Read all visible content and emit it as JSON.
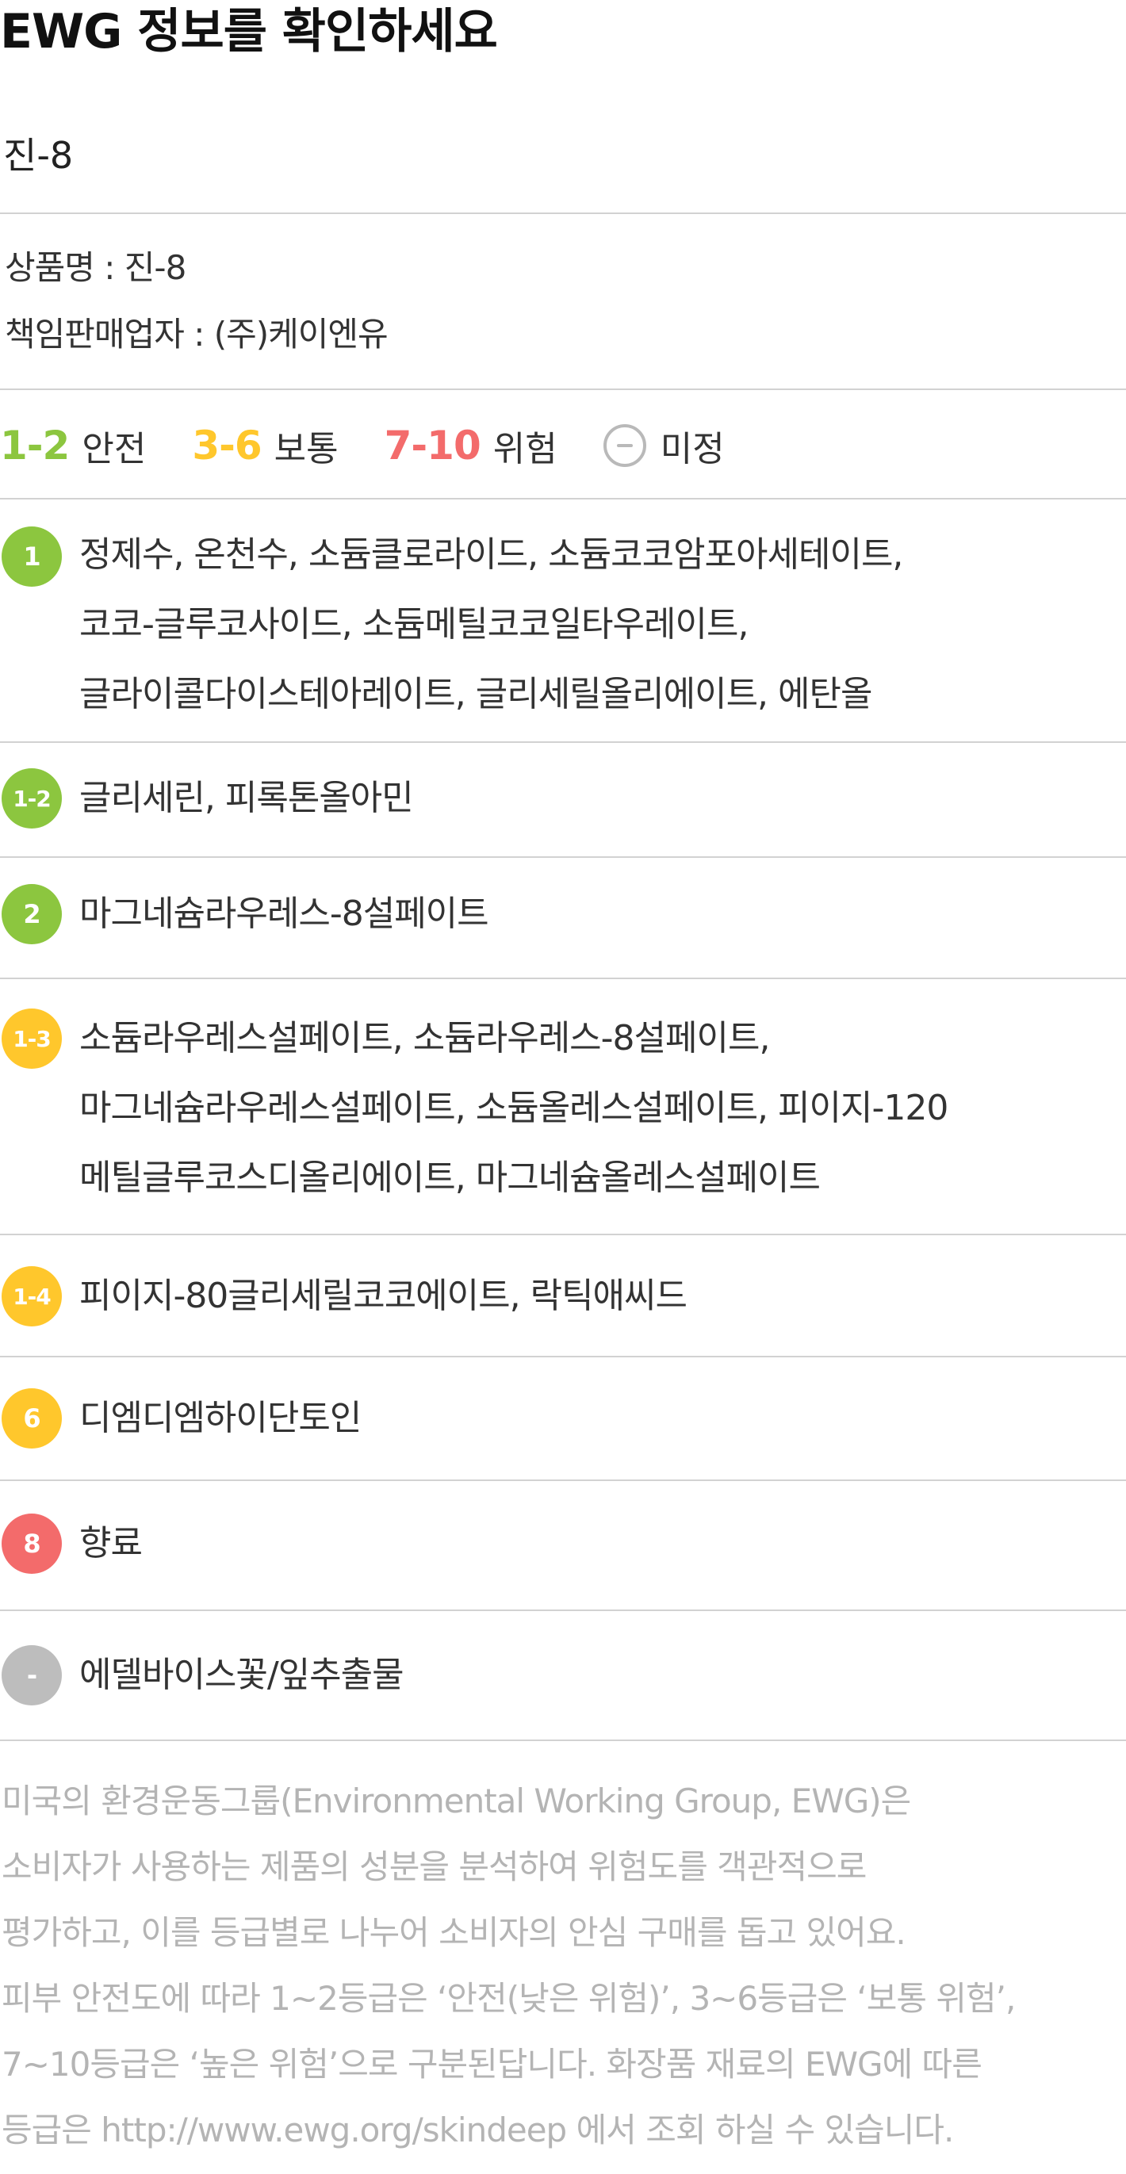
{
  "header": {
    "title": "EWG 정보를 확인하세요",
    "product_name": "진-8"
  },
  "product_info": {
    "product_line": "상품명 : 진-8",
    "seller_line": "책임판매업자 : (주)케이엔유"
  },
  "legend": {
    "safe": {
      "range": "1-2",
      "label": "안전",
      "color": "#8cc63f"
    },
    "moderate": {
      "range": "3-6",
      "label": "보통",
      "color": "#ffc72c"
    },
    "danger": {
      "range": "7-10",
      "label": "위험",
      "color": "#f36b6b"
    },
    "undetermined": {
      "label": "미정",
      "color": "#b9b9b9"
    }
  },
  "colors": {
    "green": "#8cc63f",
    "yellow": "#ffc72c",
    "red": "#f36b6b",
    "gray": "#bdbdbd"
  },
  "groups": [
    {
      "grade": "1",
      "color": "green",
      "lines": [
        "정제수, 온천수, 소듐클로라이드, 소듐코코암포아세테이트,",
        "코코-글루코사이드, 소듐메틸코코일타우레이트,",
        "글라이콜다이스테아레이트, 글리세릴올리에이트, 에탄올"
      ]
    },
    {
      "grade": "1-2",
      "color": "green",
      "lines": [
        "글리세린, 피록톤올아민"
      ]
    },
    {
      "grade": "2",
      "color": "green",
      "lines": [
        "마그네슘라우레스-8설페이트"
      ]
    },
    {
      "grade": "1-3",
      "color": "yellow",
      "lines": [
        "소듐라우레스설페이트, 소듐라우레스-8설페이트,",
        "마그네슘라우레스설페이트, 소듐올레스설페이트, 피이지-120",
        "메틸글루코스디올리에이트, 마그네슘올레스설페이트"
      ]
    },
    {
      "grade": "1-4",
      "color": "yellow",
      "lines": [
        "피이지-80글리세릴코코에이트, 락틱애씨드"
      ]
    },
    {
      "grade": "6",
      "color": "yellow",
      "lines": [
        "디엠디엠하이단토인"
      ]
    },
    {
      "grade": "8",
      "color": "red",
      "lines": [
        "향료"
      ]
    },
    {
      "grade": "-",
      "color": "gray",
      "lines": [
        "에델바이스꽃/잎추출물"
      ]
    }
  ],
  "disclaimer": {
    "lines": [
      "미국의 환경운동그룹(Environmental Working Group, EWG)은",
      "소비자가 사용하는 제품의 성분을 분석하여 위험도를 객관적으로",
      "평가하고, 이를 등급별로 나누어 소비자의 안심 구매를 돕고 있어요.",
      "피부 안전도에 따라 1~2등급은 ‘안전(낮은 위험)’, 3~6등급은 ‘보통 위험’,",
      "7~10등급은 ‘높은 위험’으로 구분된답니다. 화장품 재료의 EWG에 따른",
      "등급은 http://www.ewg.org/skindeep 에서 조회 하실 수 있습니다."
    ]
  }
}
